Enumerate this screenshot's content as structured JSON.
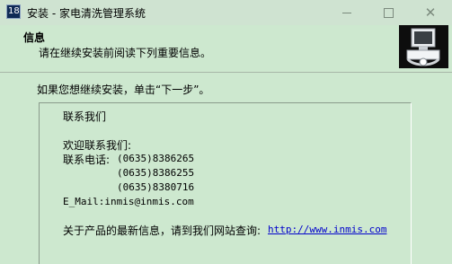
{
  "window": {
    "title": "安装 - 家电清洗管理系统",
    "app_icon_text": "18",
    "controls": {
      "minimize": "—",
      "maximize": "□",
      "close": "✕"
    }
  },
  "header": {
    "title": "信息",
    "subtitle": "请在继续安装前阅读下列重要信息。"
  },
  "main": {
    "instruction": "如果您想继续安装，单击“下一步”。",
    "info": {
      "heading": "联系我们",
      "welcome": "欢迎联系我们:",
      "phone_label": "联系电话:",
      "phones": [
        "(0635)8386265",
        "(0635)8386255",
        "(0635)8380716"
      ],
      "email": "E_Mail:inmis@inmis.com",
      "website_text": "关于产品的最新信息，请到我们网站查询:",
      "website_link": "http://www.inmis.com"
    }
  }
}
